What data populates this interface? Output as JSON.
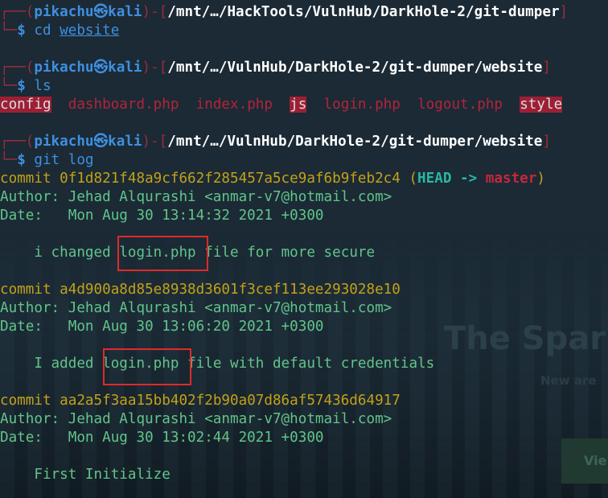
{
  "terminal": {
    "prompt_user": "pikachu",
    "prompt_symbol": "㉿",
    "prompt_host": "kali",
    "prompt_dollar": "$",
    "blocks": [
      {
        "cwd": "/mnt/…/HackTools/VulnHub/DarkHole-2/git-dumper",
        "command": "cd",
        "argument": "website"
      },
      {
        "cwd": "/mnt/…/VulnHub/DarkHole-2/git-dumper/website",
        "command": "ls"
      },
      {
        "cwd": "/mnt/…/VulnHub/DarkHole-2/git-dumper/website",
        "command": "git",
        "argument": "log"
      }
    ],
    "ls_output": [
      "config",
      "dashboard.php",
      "index.php",
      "js",
      "login.php",
      "logout.php",
      "style"
    ],
    "commits": [
      {
        "commit_label": "commit",
        "hash": "0f1d821f48a9cf662f285457a5ce9af6b9feb2c4",
        "head": "HEAD",
        "arrow": "->",
        "branch": "master",
        "author_line": "Author: Jehad Alqurashi <anmar-v7@hotmail.com>",
        "date_line": "Date:   Mon Aug 30 13:14:32 2021 +0300",
        "msg_prefix": "i changed",
        "msg_file": "login.php",
        "msg_suffix": "file for more secure"
      },
      {
        "commit_label": "commit",
        "hash": "a4d900a8d85e8938d3601f3cef113ee293028e10",
        "author_line": "Author: Jehad Alqurashi <anmar-v7@hotmail.com>",
        "date_line": "Date:   Mon Aug 30 13:06:20 2021 +0300",
        "msg_prefix": "I added",
        "msg_file": "login.php",
        "msg_suffix": "file with default credentials"
      },
      {
        "commit_label": "commit",
        "hash": "aa2a5f3aa15bb402f2b90a07d86af57436d64917",
        "author_line": "Author: Jehad Alqurashi <anmar-v7@hotmail.com>",
        "date_line": "Date:   Mon Aug 30 13:02:44 2021 +0300",
        "message": "First Initialize"
      }
    ]
  },
  "wallpaper": {
    "title": "The Spar",
    "subtitle": "New are",
    "button": "Vie"
  },
  "colors": {
    "prompt_blue": "#3f8fe0",
    "commit_yellow": "#c3a11a",
    "text_green": "#62c48a",
    "annotation_red": "#e02a2a"
  }
}
